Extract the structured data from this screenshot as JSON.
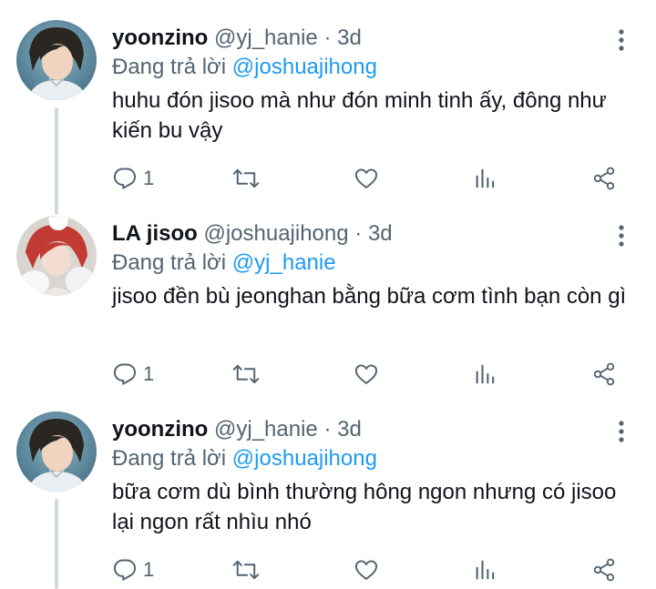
{
  "tweets": [
    {
      "name": "yoonzino",
      "handle": "@yj_hanie",
      "separator": "·",
      "time": "3d",
      "reply_prefix": "Đang trả lời ",
      "reply_to": "@joshuajihong",
      "text": "huhu đón jisoo mà như đón minh tinh ấy, đông như kiến bu vậy",
      "reply_count": "1"
    },
    {
      "name": "LA jisoo",
      "handle": "@joshuajihong",
      "separator": "·",
      "time": "3d",
      "reply_prefix": "Đang trả lời ",
      "reply_to": "@yj_hanie",
      "text": "jisoo đền bù jeonghan bằng bữa cơm tình bạn còn gì",
      "reply_count": "1"
    },
    {
      "name": "yoonzino",
      "handle": "@yj_hanie",
      "separator": "·",
      "time": "3d",
      "reply_prefix": "Đang trả lời ",
      "reply_to": "@joshuajihong",
      "text": "bữa cơm dù bình thường hông ngon nhưng có jisoo lại ngon rất nhìu nhó",
      "reply_count": "1"
    }
  ],
  "icons": [
    "more-icon",
    "reply-icon",
    "retweet-icon",
    "like-icon",
    "views-icon",
    "share-icon"
  ],
  "colors": {
    "text": "#0f1419",
    "secondary": "#536471",
    "mention": "#1d9bf0",
    "thread_line": "#cfd9de"
  }
}
